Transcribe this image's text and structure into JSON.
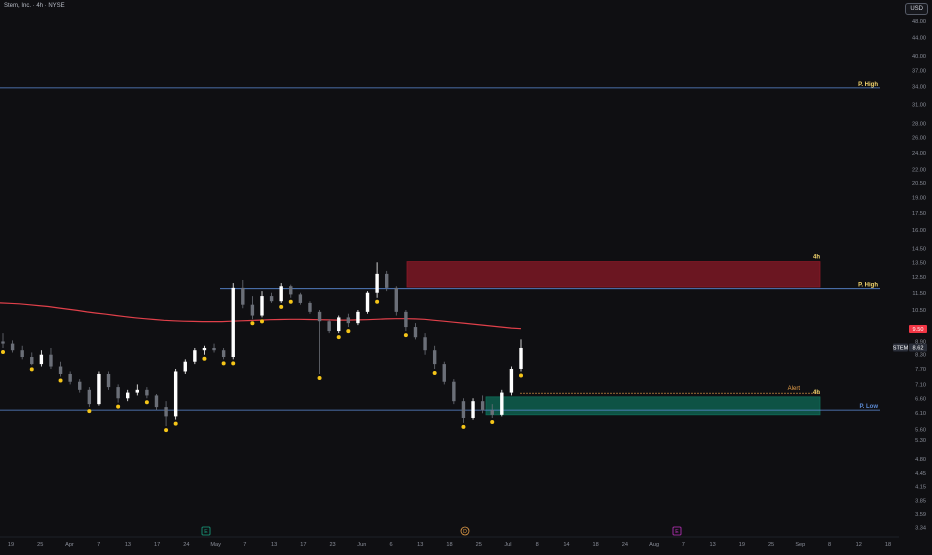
{
  "header": {
    "symbol_title": "Stem, Inc. · 4h · NYSE",
    "currency": "USD"
  },
  "colors": {
    "background": "#0f0f12",
    "bull_candle": "#ffffff",
    "bear_candle": "#6b6f78",
    "ma_line": "#e0404a",
    "level_line": "#5c8bd6",
    "pivot_dot": "#f5c518",
    "supply_zone": "#8b1a27",
    "demand_zone": "#0f6b57",
    "high_label": "#f5d76e",
    "low_label": "#5c8bd6",
    "alert_label": "#e8a04a"
  },
  "chart_data": {
    "type": "candlestick",
    "y_scale": "log",
    "ylim": [
      3.3,
      52
    ],
    "y_ticks": [
      "48.00",
      "44.00",
      "40.00",
      "37.00",
      "34.00",
      "31.00",
      "28.00",
      "26.00",
      "24.00",
      "22.00",
      "20.50",
      "19.00",
      "17.50",
      "16.00",
      "14.50",
      "13.50",
      "12.50",
      "11.50",
      "10.50",
      "9.50",
      "8.90",
      "8.30",
      "7.70",
      "7.10",
      "6.60",
      "6.10",
      "5.60",
      "5.30",
      "4.80",
      "4.45",
      "4.15",
      "3.85",
      "3.59",
      "3.34"
    ],
    "x_ticks": [
      "19",
      "25",
      "Apr",
      "7",
      "13",
      "17",
      "24",
      "May",
      "7",
      "13",
      "17",
      "23",
      "Jun",
      "6",
      "13",
      "18",
      "25",
      "Jul",
      "8",
      "14",
      "18",
      "24",
      "Aug",
      "7",
      "13",
      "19",
      "25",
      "Sep",
      "8",
      "12",
      "18"
    ],
    "candles": [
      {
        "o": 8.9,
        "h": 9.3,
        "l": 8.6,
        "c": 8.8
      },
      {
        "o": 8.8,
        "h": 8.95,
        "l": 8.4,
        "c": 8.5
      },
      {
        "o": 8.5,
        "h": 8.7,
        "l": 8.1,
        "c": 8.2
      },
      {
        "o": 8.2,
        "h": 8.4,
        "l": 7.85,
        "c": 7.9
      },
      {
        "o": 7.9,
        "h": 8.5,
        "l": 7.8,
        "c": 8.3
      },
      {
        "o": 8.3,
        "h": 8.6,
        "l": 7.7,
        "c": 7.8
      },
      {
        "o": 7.8,
        "h": 8.0,
        "l": 7.4,
        "c": 7.5
      },
      {
        "o": 7.5,
        "h": 7.6,
        "l": 7.1,
        "c": 7.2
      },
      {
        "o": 7.2,
        "h": 7.3,
        "l": 6.8,
        "c": 6.9
      },
      {
        "o": 6.9,
        "h": 7.0,
        "l": 6.3,
        "c": 6.4
      },
      {
        "o": 6.4,
        "h": 7.6,
        "l": 6.35,
        "c": 7.5
      },
      {
        "o": 7.5,
        "h": 7.6,
        "l": 6.9,
        "c": 7.0
      },
      {
        "o": 7.0,
        "h": 7.1,
        "l": 6.45,
        "c": 6.6
      },
      {
        "o": 6.6,
        "h": 6.9,
        "l": 6.5,
        "c": 6.8
      },
      {
        "o": 6.8,
        "h": 7.1,
        "l": 6.7,
        "c": 6.9
      },
      {
        "o": 6.9,
        "h": 7.0,
        "l": 6.6,
        "c": 6.7
      },
      {
        "o": 6.7,
        "h": 6.75,
        "l": 6.2,
        "c": 6.3
      },
      {
        "o": 6.3,
        "h": 6.5,
        "l": 5.7,
        "c": 6.0
      },
      {
        "o": 6.0,
        "h": 7.7,
        "l": 5.9,
        "c": 7.6
      },
      {
        "o": 7.6,
        "h": 8.1,
        "l": 7.5,
        "c": 8.0
      },
      {
        "o": 8.0,
        "h": 8.6,
        "l": 7.9,
        "c": 8.5
      },
      {
        "o": 8.5,
        "h": 8.7,
        "l": 8.3,
        "c": 8.6
      },
      {
        "o": 8.6,
        "h": 8.8,
        "l": 8.4,
        "c": 8.5
      },
      {
        "o": 8.5,
        "h": 8.6,
        "l": 8.1,
        "c": 8.2
      },
      {
        "o": 8.2,
        "h": 12.1,
        "l": 8.1,
        "c": 11.8
      },
      {
        "o": 11.8,
        "h": 12.3,
        "l": 10.6,
        "c": 10.8
      },
      {
        "o": 10.8,
        "h": 11.3,
        "l": 10.0,
        "c": 10.2
      },
      {
        "o": 10.2,
        "h": 11.6,
        "l": 10.1,
        "c": 11.3
      },
      {
        "o": 11.3,
        "h": 11.5,
        "l": 10.9,
        "c": 11.0
      },
      {
        "o": 11.0,
        "h": 12.1,
        "l": 10.9,
        "c": 11.9
      },
      {
        "o": 11.9,
        "h": 12.0,
        "l": 11.2,
        "c": 11.4
      },
      {
        "o": 11.4,
        "h": 11.5,
        "l": 10.8,
        "c": 10.9
      },
      {
        "o": 10.9,
        "h": 11.0,
        "l": 10.3,
        "c": 10.4
      },
      {
        "o": 10.4,
        "h": 10.5,
        "l": 7.5,
        "c": 9.9
      },
      {
        "o": 9.9,
        "h": 10.0,
        "l": 9.3,
        "c": 9.4
      },
      {
        "o": 9.4,
        "h": 10.2,
        "l": 9.3,
        "c": 10.1
      },
      {
        "o": 10.1,
        "h": 10.3,
        "l": 9.6,
        "c": 9.8
      },
      {
        "o": 9.8,
        "h": 10.5,
        "l": 9.7,
        "c": 10.4
      },
      {
        "o": 10.4,
        "h": 11.6,
        "l": 10.3,
        "c": 11.5
      },
      {
        "o": 11.5,
        "h": 13.5,
        "l": 11.2,
        "c": 12.7
      },
      {
        "o": 12.7,
        "h": 12.9,
        "l": 11.6,
        "c": 11.8
      },
      {
        "o": 11.8,
        "h": 11.9,
        "l": 10.2,
        "c": 10.4
      },
      {
        "o": 10.4,
        "h": 10.5,
        "l": 9.4,
        "c": 9.6
      },
      {
        "o": 9.6,
        "h": 9.8,
        "l": 9.0,
        "c": 9.1
      },
      {
        "o": 9.1,
        "h": 9.3,
        "l": 8.3,
        "c": 8.5
      },
      {
        "o": 8.5,
        "h": 8.7,
        "l": 7.7,
        "c": 7.9
      },
      {
        "o": 7.9,
        "h": 8.0,
        "l": 7.1,
        "c": 7.2
      },
      {
        "o": 7.2,
        "h": 7.3,
        "l": 6.4,
        "c": 6.5
      },
      {
        "o": 6.5,
        "h": 6.6,
        "l": 5.8,
        "c": 5.95
      },
      {
        "o": 5.95,
        "h": 6.6,
        "l": 5.9,
        "c": 6.5
      },
      {
        "o": 6.5,
        "h": 6.7,
        "l": 6.1,
        "c": 6.2
      },
      {
        "o": 6.2,
        "h": 6.4,
        "l": 5.95,
        "c": 6.05
      },
      {
        "o": 6.05,
        "h": 6.9,
        "l": 6.0,
        "c": 6.8
      },
      {
        "o": 6.8,
        "h": 7.8,
        "l": 6.7,
        "c": 7.7
      },
      {
        "o": 7.7,
        "h": 9.0,
        "l": 7.6,
        "c": 8.6
      }
    ],
    "ma_series": [
      10.9,
      10.88,
      10.85,
      10.8,
      10.75,
      10.7,
      10.62,
      10.55,
      10.48,
      10.4,
      10.33,
      10.27,
      10.2,
      10.14,
      10.08,
      10.03,
      9.99,
      9.95,
      9.92,
      9.9,
      9.89,
      9.88,
      9.88,
      9.88,
      9.9,
      9.92,
      9.94,
      9.96,
      9.98,
      9.99,
      10.0,
      10.0,
      9.99,
      9.98,
      9.97,
      9.96,
      9.96,
      9.97,
      9.98,
      10.0,
      10.02,
      10.03,
      10.03,
      10.02,
      10.0,
      9.95,
      9.9,
      9.85,
      9.8,
      9.75,
      9.7,
      9.65,
      9.6,
      9.55,
      9.52
    ],
    "levels": [
      {
        "label": "P. High",
        "price": 33.8
      },
      {
        "label": "P. High",
        "price": 11.75
      },
      {
        "label": "P. Low",
        "price": 6.2
      }
    ],
    "zones": [
      {
        "timeframe": "4h",
        "top": 13.55,
        "bottom": 11.85,
        "kind": "supply"
      },
      {
        "timeframe": "4h",
        "top": 6.65,
        "bottom": 6.05,
        "kind": "demand"
      }
    ],
    "alert": {
      "label": "Alert",
      "price": 6.78
    },
    "price_labels": [
      {
        "text": "9.50",
        "price": 9.5,
        "color": "#f23645"
      },
      {
        "text": "STEM",
        "price": 8.62,
        "color": "#2a2e39"
      },
      {
        "text": "8.62",
        "price": 8.62,
        "color": "#2a2e39"
      }
    ],
    "event_markers": [
      {
        "glyph": "E",
        "color": "#1aa584"
      },
      {
        "glyph": "D",
        "color": "#e8a04a"
      },
      {
        "glyph": "E",
        "color": "#c233c4"
      }
    ]
  }
}
